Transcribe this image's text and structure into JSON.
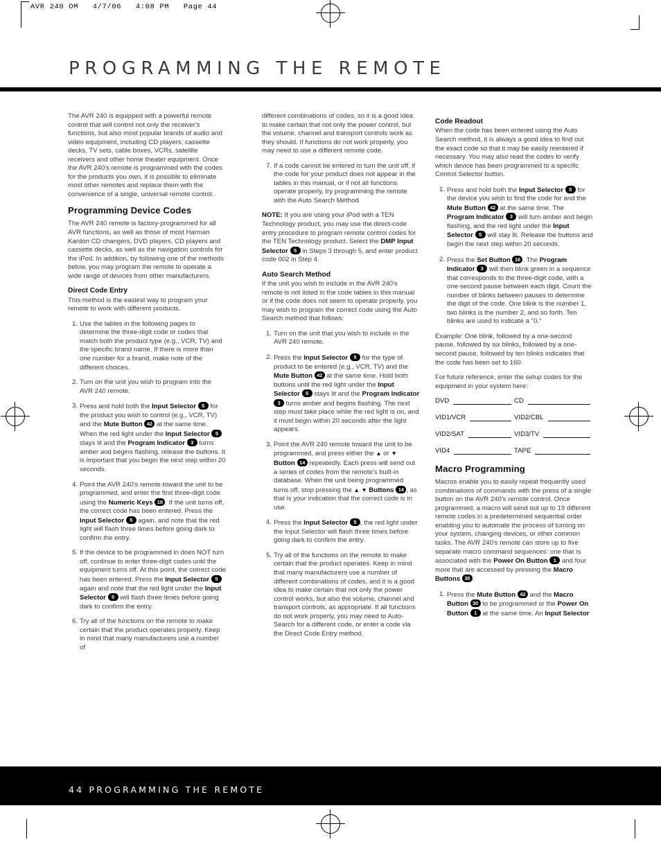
{
  "printer_slug": "AVR 240 OM   4/7/06   4:08 PM   Page 44",
  "page_title": "PROGRAMMING THE REMOTE",
  "footer": "44 PROGRAMMING THE REMOTE",
  "colors": {
    "ink": "#231f20",
    "body": "#3a3a3a",
    "bar": "#000000"
  },
  "column1": {
    "intro": "The AVR 240 is equipped with a powerful remote control that will control not only the receiver's functions, but also most popular brands of audio and video equipment, including CD players, cassette decks, TV sets, cable boxes, VCRs, satellite receivers and other home theater equipment. Once the AVR 240's remote is programmed with the codes for the products you own, it is possible to eliminate most other remotes and replace them with the convenience of a single, universal remote control.",
    "heading": "Programming Device Codes",
    "heading_body": "The AVR 240 remote is factory-programmed for all AVR functions, as well as those of most Harman Kardon CD changers, DVD players, CD players and cassette decks, as well as the navigation controls for the iPod. In addition, by following one of the methods below, you may program the remote to operate a wide range of devices from other manufacturers.",
    "subheading": "Direct Code Entry",
    "subheading_body": "This method is the easiest way to program your remote to work with different products.",
    "steps": [
      {
        "num": "1.",
        "text": "Use the tables in the following pages to determine the three-digit code or codes that match both the product type (e.g., VCR, TV) and the specific brand name. If there is more than one number for a brand, make note of the different choices."
      },
      {
        "num": "2.",
        "text": "Turn on the unit you wish to program into the AVR 240 remote."
      },
      {
        "num": "3."
      },
      {
        "num": "4."
      },
      {
        "num": "5."
      },
      {
        "num": "6.",
        "text": "Try all of the functions on the remote to make certain that the product operates properly. Keep in mind that many manufacturers use a number of"
      }
    ],
    "step3": {
      "a": "Press and hold both the ",
      "b1": "Input Selector",
      "badge1": "5",
      "c": " for the product you wish to control (e.g., VCR, TV) and the ",
      "b2": "Mute Button",
      "badge2": "42",
      "d": " at the same time. When the red light under the ",
      "b3": "Input Selector",
      "badge3": "5",
      "e": " stays lit and the ",
      "b4": "Program Indicator",
      "badge4": "3",
      "f": " turns amber and begins flashing, release the buttons. It is important that you begin the next step within 20 seconds."
    },
    "step4": {
      "a": "Point the AVR 240's remote toward the unit to be programmed, and enter the first three-digit code using the ",
      "b1": "Numeric Keys",
      "badge1": "18",
      "c": ". If the unit turns off, the correct code has been entered. Press the ",
      "b2": "Input Selector",
      "badge2": "5",
      "d": " again, and note that the red light will flash three times before going dark to confirm the entry."
    },
    "step5": {
      "a": "If the device to be programmed in does NOT turn off, continue to enter three-digit codes until the equipment turns off. At this point, the correct code has been entered. Press the ",
      "b1": "Input Selector",
      "badge1": "5",
      "c": " again and note that the red light under the ",
      "b2": "Input Selector",
      "badge2": "5",
      "d": " will flash three times before going dark to confirm the entry."
    }
  },
  "column2": {
    "cont": "different combinations of codes, so it is a good idea to make certain that not only the power control, but the volume, channel and transport controls work as they should. If functions do not work properly, you may need to use a different remote code.",
    "step7": {
      "num": "7.",
      "text": "If a code cannot be entered to turn the unit off, if the code for your product does not appear in the tables in this manual, or if not all functions operate properly, try programming the remote with the Auto Search Method."
    },
    "note": {
      "lead": "NOTE:",
      "a": " If you are using your iPod with a TEN Technology product, you may use the direct-code entry procedure to program remote control codes for the TEN Technology product. Select the ",
      "b1": "DMP Input Selector",
      "badge1": "5",
      "c": " in Steps 3 through 5, and enter product code 002 in Step 4."
    },
    "subheading": "Auto Search Method",
    "subheading_body": "If the unit you wish to include in the AVR 240's remote is not listed in the code tables in this manual or if the code does not seem to operate properly, you may wish to program the correct code using the Auto Search method that follows:",
    "step1": {
      "num": "1.",
      "text": "Turn on the unit that you wish to include in the AVR 240 remote."
    },
    "step2": {
      "num": "2.",
      "a": "Press the ",
      "b1": "Input Selector",
      "badge1": "5",
      "c": " for the type of product to be entered (e.g., VCR, TV) and the ",
      "b2": "Mute Button",
      "badge2": "42",
      "d": " at the same time. Hold both buttons until the red light under the ",
      "b3": "Input Selector",
      "badge3": "5",
      "e": " stays lit and the ",
      "b4": "Program Indicator",
      "badge4": "3",
      "f": " turns amber and begins flashing. The next step must take place while the red light is on, and it must begin within 20 seconds after the light appears."
    },
    "step3": {
      "num": "3.",
      "a": "Point the AVR 240 remote toward the unit to be programmed, and press either the ",
      "tri1": "▲",
      "or": " or ",
      "tri2": "▼",
      "b1": " Button",
      "badge1": "14",
      "c": " repeatedly. Each press will send out a series of codes from the remote's built-in database. When the unit being programmed turns off, stop pressing the ",
      "tri3": "▲ ▼",
      "b2": " Buttons",
      "badge2": "14",
      "d": ", as that is your indication that the correct code is in use."
    },
    "step4": {
      "num": "4.",
      "a": "Press the ",
      "b1": "Input Selector",
      "badge1": "5",
      "c": ", the red light under the Input Selector will flash three times before going dark to confirm the entry."
    },
    "step5": {
      "num": "5.",
      "text": "Try all of the functions on the remote to make certain that the product operates. Keep in mind that many manufacturers use a number of different combinations of codes, and it is a good idea to make certain that not only the power control works, but also the volume, channel and transport controls, as appropriate. If all functions do not work properly, you may need to Auto-Search for a different code, or enter a code via the Direct Code Entry method."
    }
  },
  "column3": {
    "subheading": "Code Readout",
    "subheading_body": "When the code has been entered using the Auto Search method, it is always a good idea to find out the exact code so that it may be easily reentered if necessary. You may also read the codes to verify which device has been programmed to a specific Control Selector button.",
    "step1": {
      "num": "1.",
      "a": "Press and hold both the ",
      "b1": "Input Selector",
      "badge1": "5",
      "c": " for the device you wish to find the code for and the ",
      "b2": "Mute Button",
      "badge2": "42",
      "d": " at the same time. The ",
      "b3": "Program Indicator",
      "badge3": "3",
      "e": " will turn amber and begin flashing, and the red light under the ",
      "b4": "Input Selector",
      "badge4": "5",
      "f": " will stay lit. Release the buttons and begin the next step within 20 seconds."
    },
    "step2": {
      "num": "2.",
      "a": "Press the ",
      "b1": "Set Button",
      "badge1": "16",
      "c": ". The ",
      "b2": "Program Indicator",
      "badge2": "3",
      "d": " will then blink green in a sequence that corresponds to the three-digit code, with a one-second pause between each digit. Count the number of blinks between pauses to determine the digit of the code. One blink is the number 1, two blinks is the number 2, and so forth. Ten blinks are used to indicate a \"0.\""
    },
    "example": "Example: One blink, followed by a one-second pause, followed by six blinks, followed by a one-second pause, followed by ten blinks indicates that the code has been set to 160.",
    "future": "For future reference, enter the setup codes for the equipment in your system here:",
    "code_table": [
      [
        "DVD",
        "CD"
      ],
      [
        "VID1/VCR",
        "VID2/CBL"
      ],
      [
        "VID2/SAT",
        "VID3/TV"
      ],
      [
        "VID4",
        "TAPE"
      ]
    ],
    "macro_heading": "Macro Programming",
    "macro_body": {
      "a": "Macros enable you to easily repeat frequently used combinations of commands with the press of a single button on the AVR 240's remote control. Once programmed, a macro will send out up to 19 different remote codes in a predetermined sequential order enabling you to automate the process of turning on your system, changing devices, or other common tasks. The AVR 240's remote can store up to five separate macro command sequences: one that is associated with the ",
      "b1": "Power On Button",
      "badge1": "1",
      "c": " and four more that are accessed by pressing the ",
      "b2": "Macro Buttons",
      "badge2": "30",
      "d": "."
    },
    "macro_step1": {
      "num": "1.",
      "a": "Press the ",
      "b1": "Mute Button",
      "badge1": "42",
      "c": " and the ",
      "b2": "Macro Button",
      "badge2": "30",
      "d": " to be programmed or the ",
      "b3": "Power On Button",
      "badge3": "1",
      "e": " at the same time. An ",
      "b4": "Input Selector"
    }
  }
}
